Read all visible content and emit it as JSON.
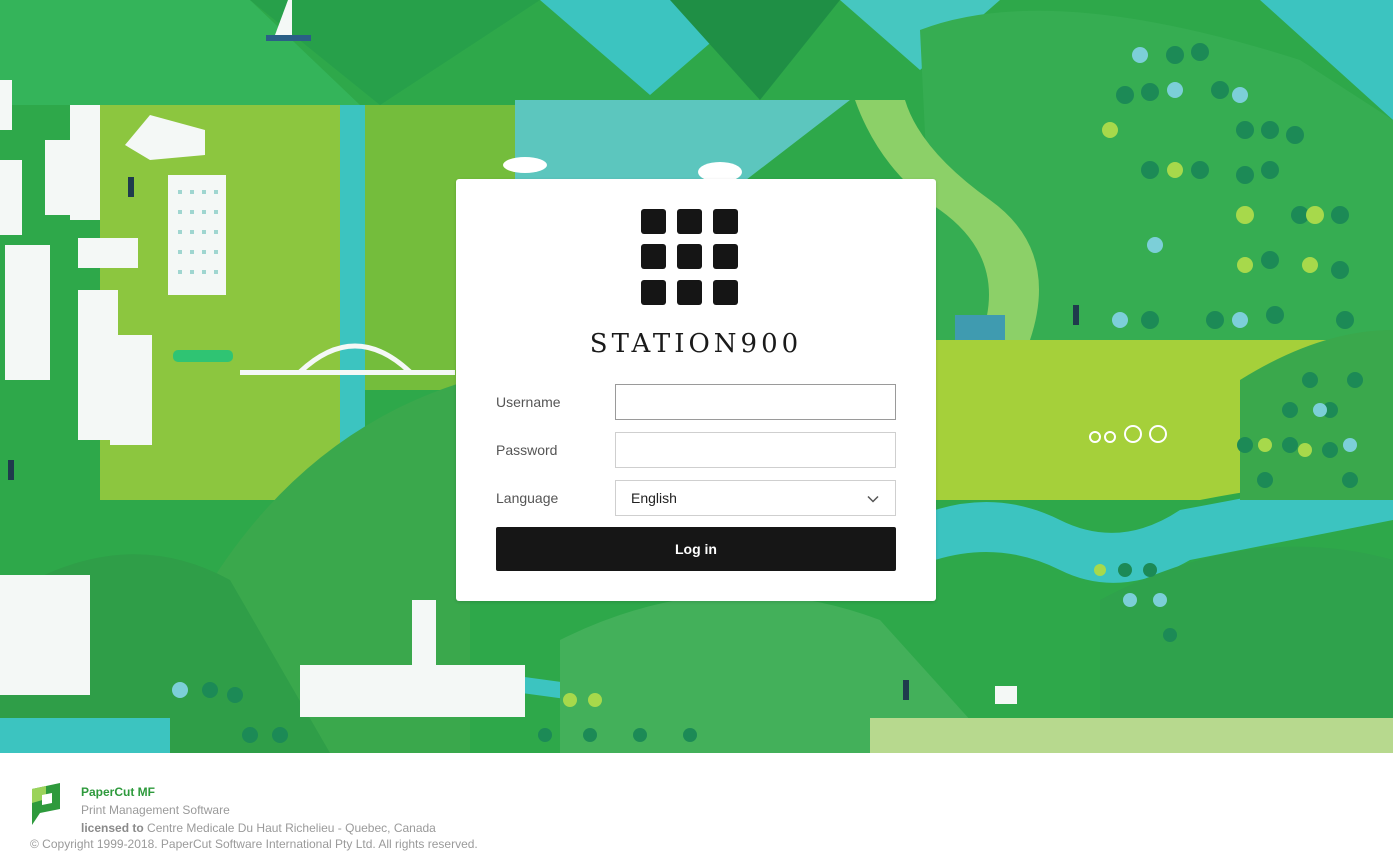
{
  "brand": {
    "name": "STATION900"
  },
  "login": {
    "username_label": "Username",
    "username_value": "",
    "password_label": "Password",
    "password_value": "",
    "language_label": "Language",
    "language_selected": "English",
    "submit_label": "Log in"
  },
  "footer": {
    "product_name": "PaperCut MF",
    "product_tagline": "Print Management Software",
    "licensed_label": "licensed to",
    "licensee": "Centre Medicale Du Haut Richelieu - Quebec, Canada",
    "copyright": "© Copyright 1999-2018. PaperCut Software International Pty Ltd. All rights reserved."
  },
  "colors": {
    "button_bg": "#161616",
    "product_green": "#2e9a3c",
    "bg_green": "#2ea84a",
    "bg_teal": "#3cc4c0",
    "bg_lime": "#9ccc3a"
  },
  "icons": {
    "logo_mark": "station900-grid-logo",
    "select_arrow": "chevron-down-icon",
    "papercut_logo": "papercut-logo-icon"
  }
}
